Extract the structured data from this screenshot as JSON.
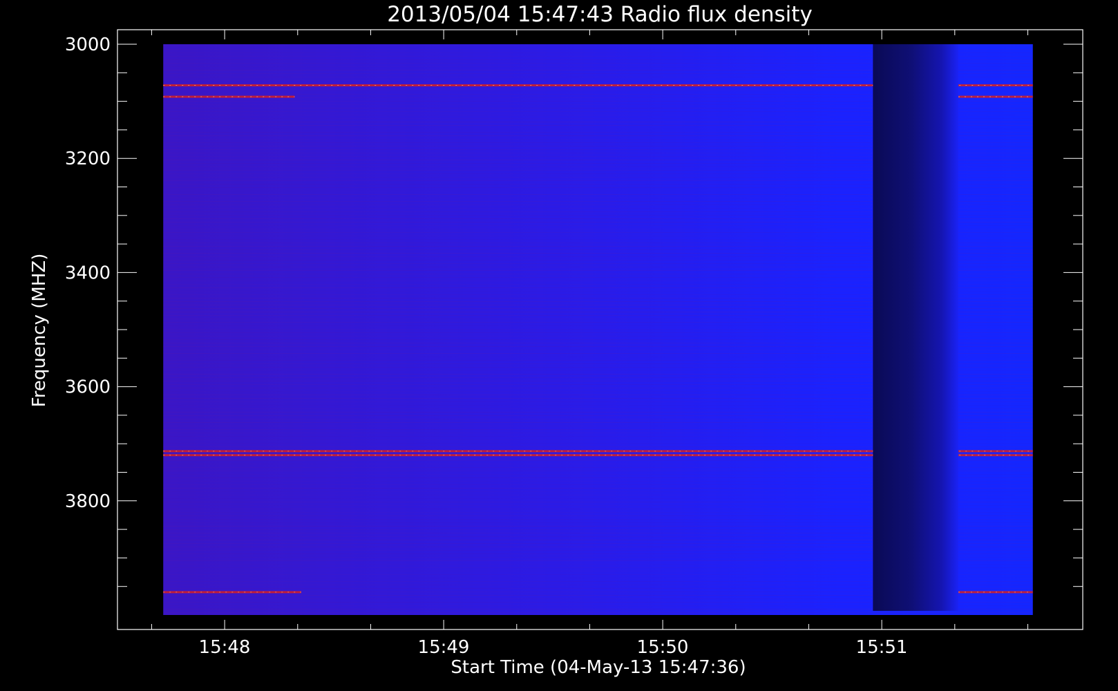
{
  "chart_data": {
    "type": "heatmap",
    "title": "2013/05/04 15:47:43 Radio flux density",
    "xlabel": "Start Time (04-May-13 15:47:36)",
    "ylabel": "Frequency (MHZ)",
    "x_ticks": [
      {
        "label": "15:48",
        "minutes_after_1548": 0
      },
      {
        "label": "15:49",
        "minutes_after_1548": 1
      },
      {
        "label": "15:50",
        "minutes_after_1548": 2
      },
      {
        "label": "15:51",
        "minutes_after_1548": 3
      }
    ],
    "y_ticks": [
      3000,
      3200,
      3400,
      3600,
      3800
    ],
    "ylim": [
      3000,
      4000
    ],
    "y_reversed": true,
    "xlim_minutes_after_1548": [
      -0.5,
      3.9
    ],
    "data_time_range_minutes_after_1548": [
      -0.28,
      3.69
    ],
    "colors": {
      "background": "#0000ff",
      "dark_band": "#0a0a6a",
      "interference": "#d82020",
      "frame": "#ffffff"
    },
    "features": [
      {
        "kind": "horizontal_interference_line",
        "frequency_mhz": 3072,
        "time_range": [
          -0.28,
          3.69
        ]
      },
      {
        "kind": "horizontal_interference_line",
        "frequency_mhz": 3092,
        "time_range": [
          -0.28,
          0.32
        ]
      },
      {
        "kind": "horizontal_interference_line",
        "frequency_mhz": 3092,
        "time_range": [
          3.35,
          3.69
        ]
      },
      {
        "kind": "horizontal_interference_line",
        "frequency_mhz": 3713,
        "time_range": [
          -0.28,
          3.69
        ]
      },
      {
        "kind": "horizontal_interference_line",
        "frequency_mhz": 3720,
        "time_range": [
          -0.28,
          3.69
        ]
      },
      {
        "kind": "horizontal_interference_line",
        "frequency_mhz": 3960,
        "time_range": [
          -0.28,
          0.35
        ]
      },
      {
        "kind": "horizontal_interference_line",
        "frequency_mhz": 3960,
        "time_range": [
          3.35,
          3.69
        ]
      },
      {
        "kind": "low_flux_band",
        "time_range": [
          2.96,
          3.35
        ]
      }
    ]
  }
}
